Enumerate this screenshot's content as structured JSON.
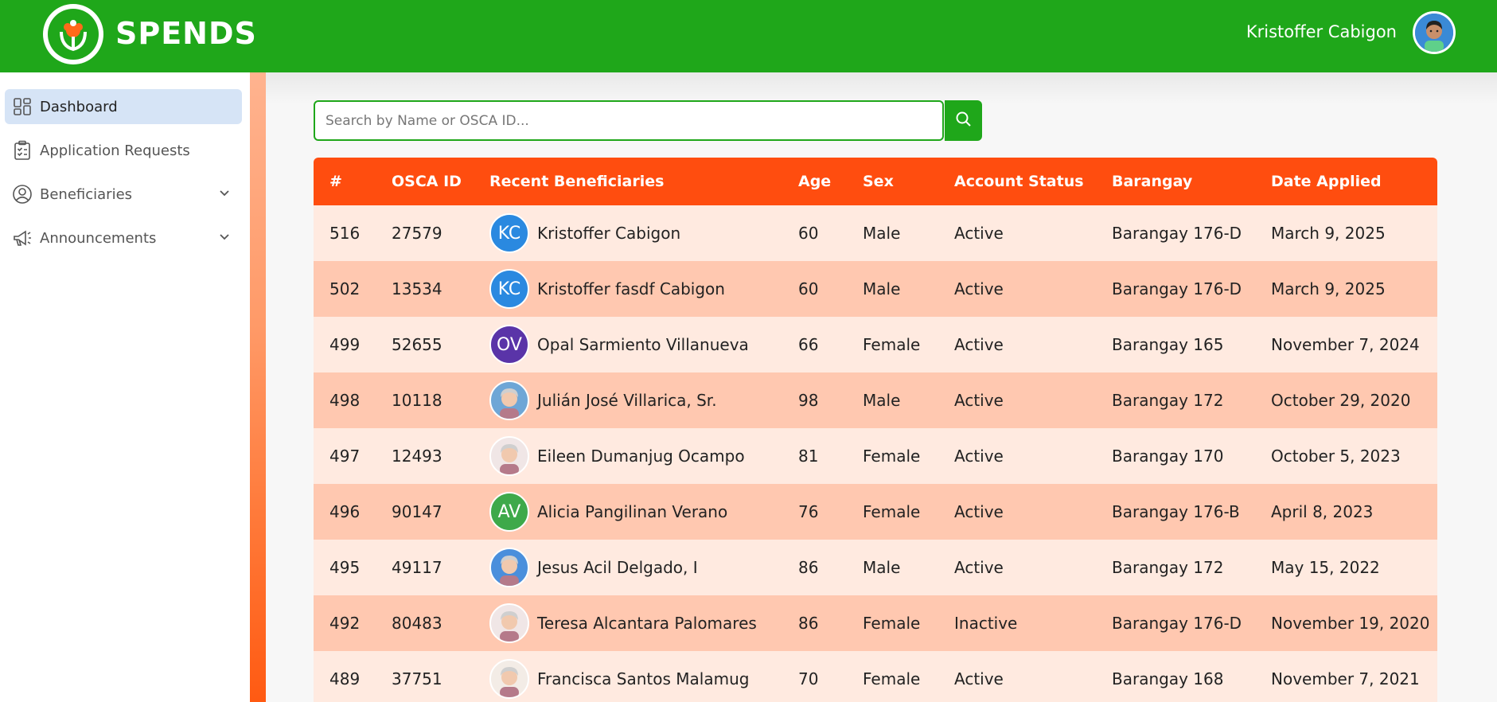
{
  "header": {
    "brand": "SPENDS",
    "user_name": "Kristoffer Cabigon",
    "color": "#1fa71a"
  },
  "sidebar": {
    "items": [
      {
        "label": "Dashboard",
        "icon": "dashboard-icon",
        "active": true
      },
      {
        "label": "Application Requests",
        "icon": "clipboard-icon",
        "active": false
      },
      {
        "label": "Beneficiaries",
        "icon": "user-circle-icon",
        "active": false,
        "expandable": true
      },
      {
        "label": "Announcements",
        "icon": "megaphone-icon",
        "active": false,
        "expandable": true
      }
    ]
  },
  "search": {
    "placeholder": "Search by Name or OSCA ID..."
  },
  "table": {
    "columns": [
      "#",
      "OSCA ID",
      "Recent Beneficiaries",
      "Age",
      "Sex",
      "Account Status",
      "Barangay",
      "Date Applied"
    ],
    "header_color": "#ff4d0f",
    "rows": [
      {
        "num": "516",
        "osca": "27579",
        "name": "Kristoffer Cabigon",
        "initials": "KC",
        "avatar_color": "#2a89e0",
        "age": "60",
        "sex": "Male",
        "status": "Active",
        "barangay": "Barangay 176-D",
        "date": "March 9, 2025"
      },
      {
        "num": "502",
        "osca": "13534",
        "name": "Kristoffer fasdf Cabigon",
        "initials": "KC",
        "avatar_color": "#2a89e0",
        "age": "60",
        "sex": "Male",
        "status": "Active",
        "barangay": "Barangay 176-D",
        "date": "March 9, 2025"
      },
      {
        "num": "499",
        "osca": "52655",
        "name": "Opal Sarmiento Villanueva",
        "initials": "OV",
        "avatar_color": "#5a34a8",
        "age": "66",
        "sex": "Female",
        "status": "Active",
        "barangay": "Barangay 165",
        "date": "November 7, 2024"
      },
      {
        "num": "498",
        "osca": "10118",
        "name": "Julián José Villarica, Sr.",
        "initials": "",
        "avatar_color": "#6ea6d6",
        "age": "98",
        "sex": "Male",
        "status": "Active",
        "barangay": "Barangay 172",
        "date": "October 29, 2020"
      },
      {
        "num": "497",
        "osca": "12493",
        "name": "Eileen Dumanjug Ocampo",
        "initials": "",
        "avatar_color": "#f0e6e6",
        "age": "81",
        "sex": "Female",
        "status": "Active",
        "barangay": "Barangay 170",
        "date": "October 5, 2023"
      },
      {
        "num": "496",
        "osca": "90147",
        "name": "Alicia Pangilinan Verano",
        "initials": "AV",
        "avatar_color": "#3ea94a",
        "age": "76",
        "sex": "Female",
        "status": "Active",
        "barangay": "Barangay 176-B",
        "date": "April 8, 2023"
      },
      {
        "num": "495",
        "osca": "49117",
        "name": "Jesus Acil Delgado, I",
        "initials": "",
        "avatar_color": "#4a8fdc",
        "age": "86",
        "sex": "Male",
        "status": "Active",
        "barangay": "Barangay 172",
        "date": "May 15, 2022"
      },
      {
        "num": "492",
        "osca": "80483",
        "name": "Teresa Alcantara Palomares",
        "initials": "",
        "avatar_color": "#f0e6e6",
        "age": "86",
        "sex": "Female",
        "status": "Inactive",
        "barangay": "Barangay 176-D",
        "date": "November 19, 2020"
      },
      {
        "num": "489",
        "osca": "37751",
        "name": "Francisca Santos Malamug",
        "initials": "",
        "avatar_color": "#f3ece6",
        "age": "70",
        "sex": "Female",
        "status": "Active",
        "barangay": "Barangay 168",
        "date": "November 7, 2021"
      }
    ]
  }
}
